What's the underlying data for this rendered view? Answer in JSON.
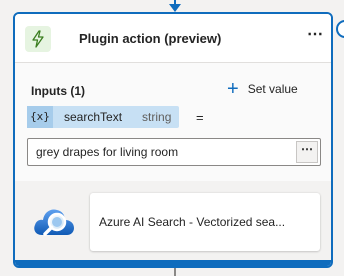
{
  "header": {
    "title": "Plugin action (preview)",
    "more_label": "⋯",
    "icon": "lightning-bolt-icon"
  },
  "inputs": {
    "label": "Inputs (1)",
    "set_value_icon": "plus-icon",
    "set_value_label": "Set value",
    "variable": {
      "icon_text": "{x}",
      "name": "searchText",
      "type": "string"
    },
    "operator": "=",
    "value": "grey drapes for living room",
    "value_more_label": "⋯"
  },
  "plugin": {
    "icon": "azure-ai-search-cloud-icon",
    "label": "Azure AI Search - Vectorized sea..."
  },
  "colors": {
    "accent": "#0f6cbd",
    "icon_bg": "#e6f4e1",
    "chip_bg": "#c7e0f4"
  }
}
